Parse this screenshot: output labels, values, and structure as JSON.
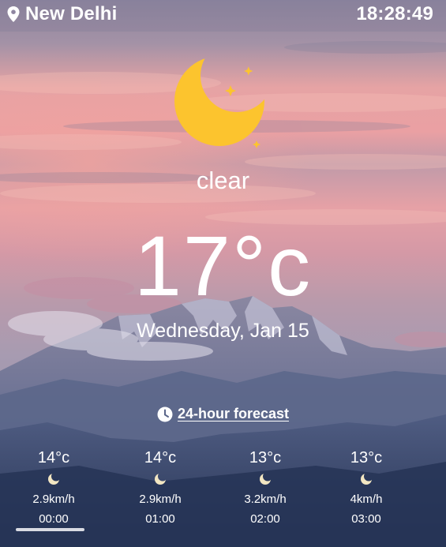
{
  "header": {
    "location": "New Delhi",
    "location_icon": "map-pin-icon",
    "time": "18:28:49"
  },
  "current": {
    "icon": "crescent-moon-icon",
    "condition": "clear",
    "temperature": "17°c",
    "date": "Wednesday, Jan 15"
  },
  "forecast": {
    "icon": "clock-icon",
    "link_label": "24-hour forecast",
    "hours": [
      {
        "temp": "14°c",
        "icon": "moon-icon",
        "wind": "2.9km/h",
        "time": "00:00"
      },
      {
        "temp": "14°c",
        "icon": "moon-icon",
        "wind": "2.9km/h",
        "time": "01:00"
      },
      {
        "temp": "13°c",
        "icon": "moon-icon",
        "wind": "3.2km/h",
        "time": "02:00"
      },
      {
        "temp": "13°c",
        "icon": "moon-icon",
        "wind": "4km/h",
        "time": "03:00"
      }
    ]
  },
  "colors": {
    "moon": "#fcc42e",
    "sky_top": "#9e8fa3",
    "sky_pink": "#e99aa1",
    "mountain_dark": "#2d3d5f"
  }
}
